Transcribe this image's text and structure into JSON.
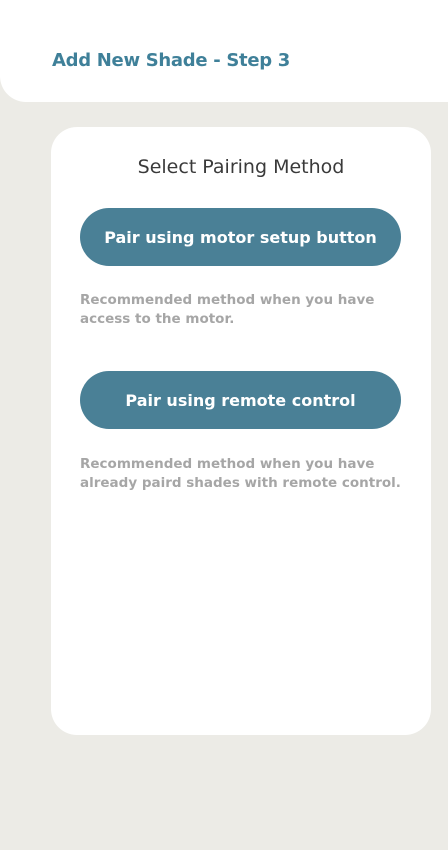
{
  "header": {
    "title": "Add New Shade - Step 3"
  },
  "card": {
    "title": "Select Pairing Method",
    "options": [
      {
        "button_label": "Pair using motor setup button",
        "description": "Recommended method when you have access to the motor."
      },
      {
        "button_label": "Pair using remote control",
        "description": "Recommended method when you have already paird shades with remote control."
      }
    ]
  },
  "colors": {
    "background": "#ecebe6",
    "surface": "#ffffff",
    "title_teal": "#3f8099",
    "button": "#4a8096",
    "description_text": "#a6a6a6"
  }
}
